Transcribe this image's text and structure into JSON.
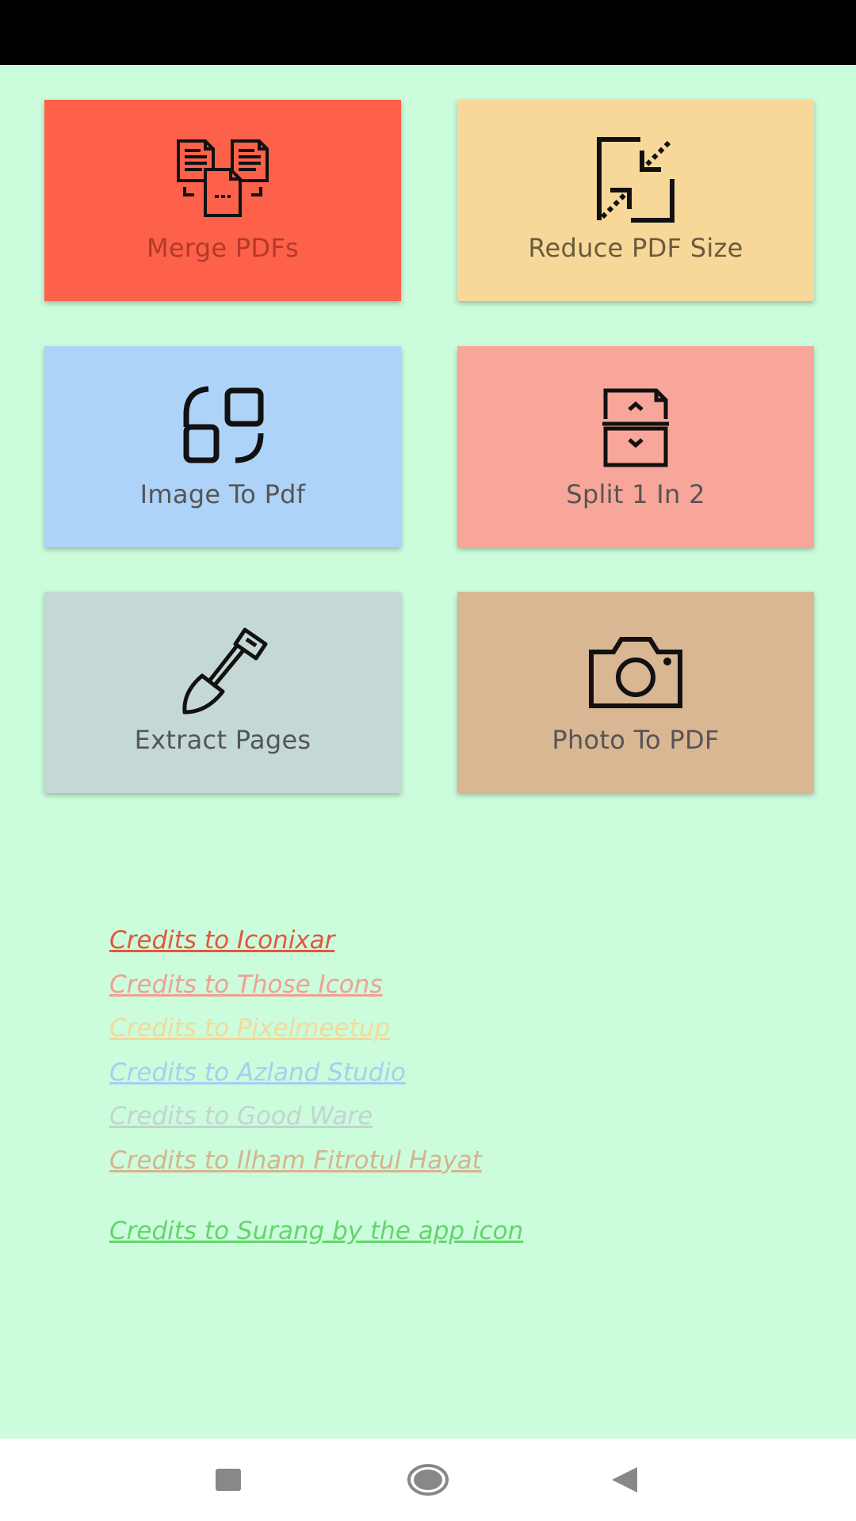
{
  "colors": {
    "background": "#cbfcdb",
    "status_bar": "#000000",
    "nav_bar": "#ffffff"
  },
  "tools": [
    {
      "label": "Merge PDFs",
      "icon": "merge-documents-icon",
      "bg": "#fe6149",
      "label_color": "#b23a2a"
    },
    {
      "label": "Reduce PDF Size",
      "icon": "compress-arrows-icon",
      "bg": "#f8d899",
      "label_color": "#6a5b3f"
    },
    {
      "label": "Image To Pdf",
      "icon": "image-convert-icon",
      "bg": "#aed3f8",
      "label_color": "#555555"
    },
    {
      "label": "Split 1 In 2",
      "icon": "split-document-icon",
      "bg": "#f8a699",
      "label_color": "#555555"
    },
    {
      "label": "Extract Pages",
      "icon": "shovel-icon",
      "bg": "#c4d9d6",
      "label_color": "#555555"
    },
    {
      "label": "Photo To PDF",
      "icon": "camera-icon",
      "bg": "#d9b793",
      "label_color": "#555555"
    }
  ],
  "credits": [
    {
      "text": "Credits to Iconixar",
      "color": "#e5553f"
    },
    {
      "text": "Credits to Those Icons",
      "color": "#f0a092"
    },
    {
      "text": "Credits to Pixelmeetup",
      "color": "#f6d89a"
    },
    {
      "text": "Credits to Azland Studio",
      "color": "#a9cdf2"
    },
    {
      "text": "Credits to Good Ware",
      "color": "#c2d4d3"
    },
    {
      "text": "Credits to Ilham Fitrotul Hayat",
      "color": "#d6b38e"
    },
    {
      "text": "Credits to Surang by the app icon",
      "color": "#64d56b"
    }
  ],
  "nav": {
    "recents_icon": "square-icon",
    "home_icon": "circle-icon",
    "back_icon": "triangle-back-icon"
  }
}
